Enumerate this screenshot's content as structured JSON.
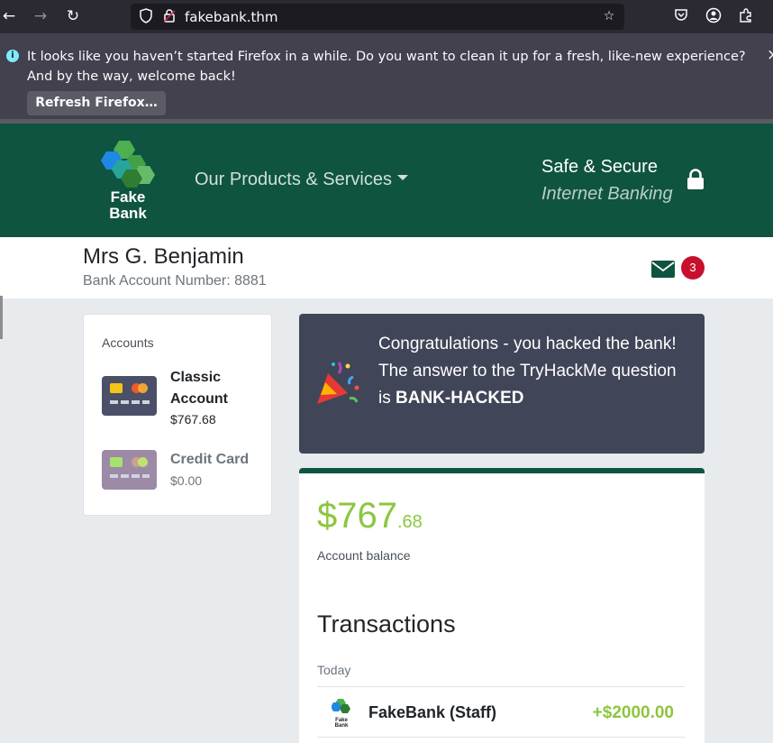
{
  "browser": {
    "url": "fakebank.thm",
    "back_icon": "arrow-left-icon",
    "forward_icon": "arrow-right-icon",
    "reload_icon": "reload-icon"
  },
  "notification": {
    "message": "It looks like you haven’t started Firefox in a while. Do you want to clean it up for a fresh, like-new experience? And by the way, welcome back!",
    "button_label": "Refresh Firefox…",
    "close": "×"
  },
  "header": {
    "logo_line1": "Fake",
    "logo_line2": "Bank",
    "products_label": "Our Products & Services",
    "safe_line1": "Safe & Secure",
    "safe_line2": "Internet Banking"
  },
  "customer": {
    "name": "Mrs G. Benjamin",
    "account_number": "Bank Account Number: 8881",
    "message_count": "3"
  },
  "accounts": {
    "title": "Accounts",
    "items": [
      {
        "name": "Classic Account",
        "balance": "$767.68"
      },
      {
        "name": "Credit Card",
        "balance": "$0.00"
      }
    ]
  },
  "congrats": {
    "line1": "Congratulations - you hacked the bank!",
    "line2_prefix": "The answer to the TryHackMe question is ",
    "answer": "BANK-HACKED"
  },
  "balance": {
    "dollars": "$767",
    "cents": ".68",
    "label": "Account balance"
  },
  "transactions": {
    "title": "Transactions",
    "day": "Today",
    "items": [
      {
        "name": "FakeBank (Staff)",
        "amount": "+$2000.00",
        "logo_line1": "Fake",
        "logo_line2": "Bank"
      }
    ]
  },
  "colors": {
    "brand_green": "#0f5440",
    "accent_lime": "#8cc63f",
    "badge_red": "#c8102e"
  }
}
